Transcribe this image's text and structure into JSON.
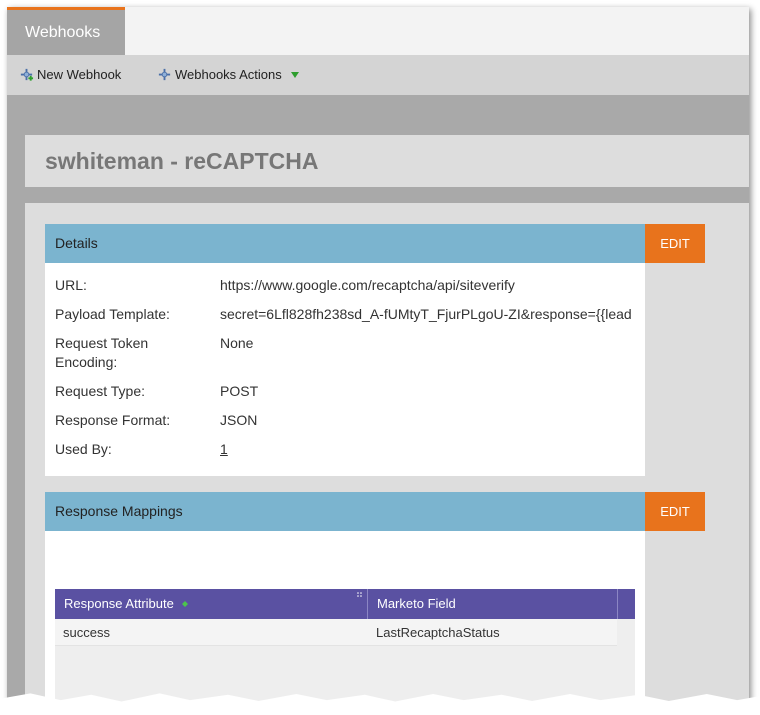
{
  "tabs": {
    "webhooks_label": "Webhooks"
  },
  "toolbar": {
    "new_webhook_label": "New Webhook",
    "webhooks_actions_label": "Webhooks Actions"
  },
  "page_title": "swhiteman - reCAPTCHA",
  "details": {
    "header": "Details",
    "edit_label": "EDIT",
    "rows": [
      {
        "label": "URL:",
        "value": "https://www.google.com/recaptcha/api/siteverify"
      },
      {
        "label": "Payload Template:",
        "value": "secret=6Lfl828fh238sd_A-fUMtyT_FjurPLgoU-ZI&response={{lead"
      },
      {
        "label": "Request Token Encoding:",
        "value": "None"
      },
      {
        "label": "Request Type:",
        "value": "POST"
      },
      {
        "label": "Response Format:",
        "value": "JSON"
      },
      {
        "label": "Used By:",
        "value": "1"
      }
    ]
  },
  "response_mappings": {
    "header": "Response Mappings",
    "edit_label": "EDIT",
    "columns": [
      "Response Attribute",
      "Marketo Field"
    ],
    "rows": [
      {
        "response_attribute": "success",
        "marketo_field": "LastRecaptchaStatus"
      }
    ]
  },
  "colors": {
    "accent_orange": "#e8731c",
    "panel_header_blue": "#7bb4cf",
    "grid_header_purple": "#5a51a2"
  }
}
